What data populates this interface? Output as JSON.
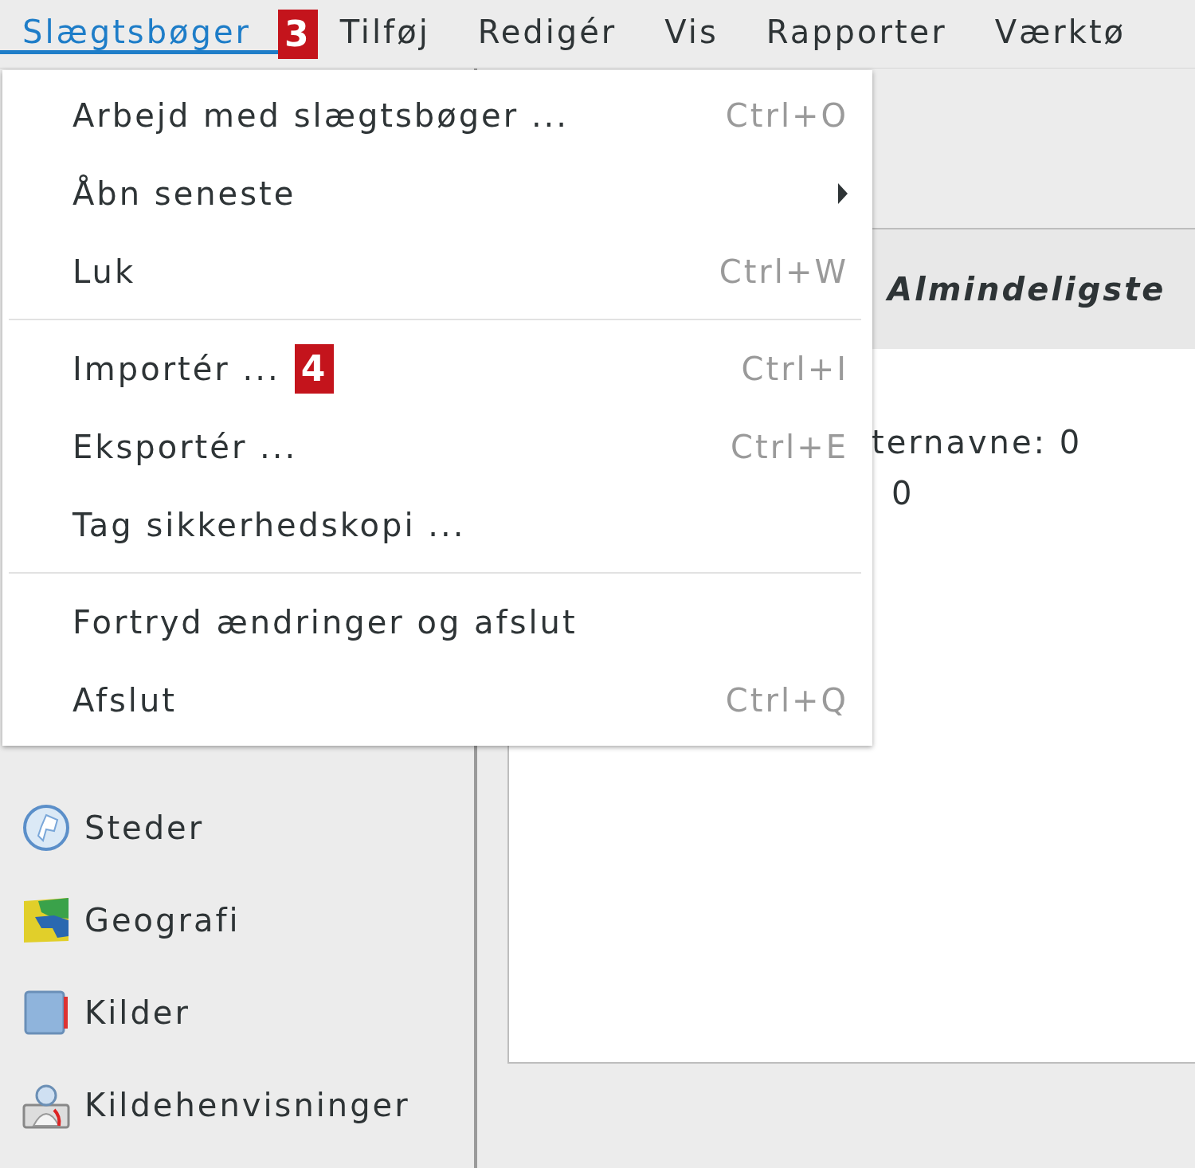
{
  "menubar": {
    "items": [
      {
        "label": "Slægtsbøger",
        "selected": true,
        "badge": "3"
      },
      {
        "label": "Tilføj",
        "selected": false
      },
      {
        "label": "Redigér",
        "selected": false
      },
      {
        "label": "Vis",
        "selected": false
      },
      {
        "label": "Rapporter",
        "selected": false
      },
      {
        "label": "Værktø",
        "selected": false
      }
    ]
  },
  "menu": {
    "items": [
      {
        "kind": "item",
        "label": "Arbejd med slægtsbøger ...",
        "shortcut": "Ctrl+O"
      },
      {
        "kind": "submenu",
        "label": "Åbn seneste"
      },
      {
        "kind": "item",
        "label": "Luk",
        "shortcut": "Ctrl+W"
      },
      {
        "kind": "separator"
      },
      {
        "kind": "item",
        "label": "Importér ...",
        "shortcut": "Ctrl+I",
        "badge": "4"
      },
      {
        "kind": "item",
        "label": "Eksportér ...",
        "shortcut": "Ctrl+E"
      },
      {
        "kind": "item",
        "label": "Tag sikkerhedskopi ..."
      },
      {
        "kind": "separator"
      },
      {
        "kind": "item",
        "label": "Fortryd ændringer og afslut"
      },
      {
        "kind": "item",
        "label": "Afslut",
        "shortcut": "Ctrl+Q"
      }
    ]
  },
  "sidebar": {
    "items": [
      {
        "label": "Steder"
      },
      {
        "label": "Geografi"
      },
      {
        "label": "Kilder"
      },
      {
        "label": "Kildehenvisninger"
      }
    ]
  },
  "panel": {
    "title": "Almindeligste",
    "lines": [
      "ternavne: 0",
      "0"
    ]
  }
}
